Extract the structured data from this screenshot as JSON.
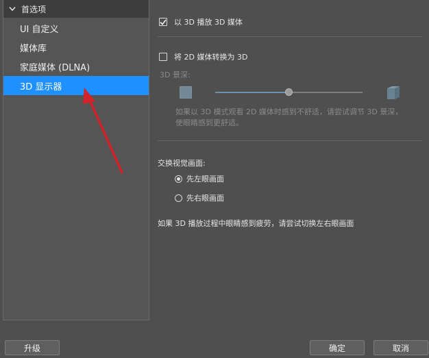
{
  "sidebar": {
    "header": "首选项",
    "items": [
      {
        "label": "UI 自定义",
        "selected": false
      },
      {
        "label": "媒体库",
        "selected": false
      },
      {
        "label": "家庭媒体 (DLNA)",
        "selected": false
      },
      {
        "label": "3D 显示器",
        "selected": true
      }
    ]
  },
  "settings": {
    "play3d_label": "以 3D 播放 3D 媒体",
    "play3d_checked": true,
    "convert2d_label": "将 2D 媒体转换为 3D",
    "convert2d_checked": false,
    "depth_label": "3D 景深:",
    "depth_value": 0.5,
    "depth_hint": "如果以 3D 模式观看 2D 媒体时感到不舒适，请尝试调节 3D 景深，使眼睛感到更舒适。",
    "swap_title": "交换视觉画面:",
    "swap_options": [
      {
        "label": "先左眼画面",
        "selected": true
      },
      {
        "label": "先右眼画面",
        "selected": false
      }
    ],
    "swap_note": "如果 3D 播放过程中眼睛感到疲劳，请尝试切换左右眼画面"
  },
  "buttons": {
    "upgrade": "升级",
    "ok": "确定",
    "cancel": "取消"
  },
  "colors": {
    "selection": "#1e90ff",
    "annotation_arrow": "#d2222a"
  }
}
